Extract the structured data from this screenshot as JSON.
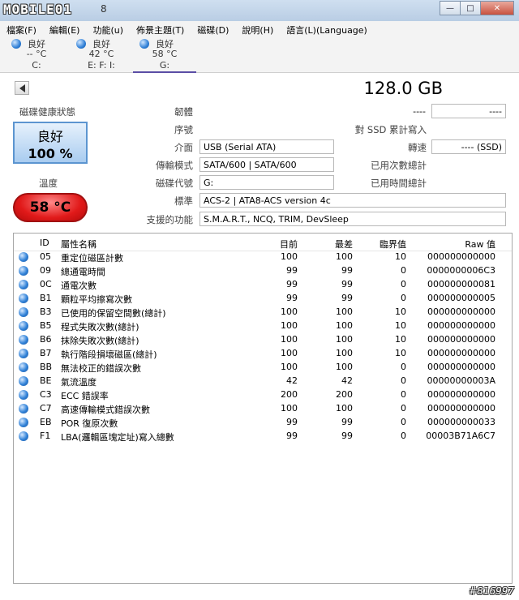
{
  "titlebar": {
    "logo": "MOBILE01",
    "version": "8",
    "controls": {
      "minimize": "—",
      "maximize": "□",
      "close": "✕"
    }
  },
  "menu": [
    "檔案(F)",
    "編輯(E)",
    "功能(u)",
    "佈景主題(T)",
    "磁碟(D)",
    "說明(H)",
    "語言(L)(Language)"
  ],
  "disks": [
    {
      "status": "良好",
      "temp": "-- °C",
      "drive": "C:"
    },
    {
      "status": "良好",
      "temp": "42 °C",
      "drive": "E: F: I:"
    },
    {
      "status": "良好",
      "temp": "58 °C",
      "drive": "G:"
    }
  ],
  "info": {
    "capacity": "128.0 GB",
    "health_label": "磁碟健康狀態",
    "health_status": "良好",
    "health_percent": "100 %",
    "temp_label": "溫度",
    "temperature": "58 °C",
    "firmware_label": "韌體",
    "firmware": "----",
    "firmware_right": "----",
    "serial_label": "序號",
    "interface_label": "介面",
    "interface": "USB (Serial ATA)",
    "transfer_label": "傳輸模式",
    "transfer": "SATA/600 | SATA/600",
    "drive_letter_label": "磁碟代號",
    "drive_letter": "G:",
    "standard_label": "標準",
    "standard": "ACS-2 | ATA8-ACS version 4c",
    "features_label": "支援的功能",
    "features": "S.M.A.R.T., NCQ, TRIM, DevSleep",
    "ssd_writes_label": "對 SSD 累計寫入",
    "rotation_label": "轉速",
    "rotation": "---- (SSD)",
    "power_count_label": "已用次數總計",
    "power_hours_label": "已用時間總計"
  },
  "smart": {
    "headers": {
      "id": "ID",
      "name": "屬性名稱",
      "current": "目前",
      "worst": "最差",
      "threshold": "臨界值",
      "raw": "Raw 值"
    },
    "rows": [
      {
        "id": "05",
        "name": "重定位磁區計數",
        "current": "100",
        "worst": "100",
        "threshold": "10",
        "raw": "000000000000"
      },
      {
        "id": "09",
        "name": "總通電時間",
        "current": "99",
        "worst": "99",
        "threshold": "0",
        "raw": "0000000006C3"
      },
      {
        "id": "0C",
        "name": "通電次數",
        "current": "99",
        "worst": "99",
        "threshold": "0",
        "raw": "000000000081"
      },
      {
        "id": "B1",
        "name": "顆粒平均擦寫次數",
        "current": "99",
        "worst": "99",
        "threshold": "0",
        "raw": "000000000005"
      },
      {
        "id": "B3",
        "name": "已使用的保留空間數(總計)",
        "current": "100",
        "worst": "100",
        "threshold": "10",
        "raw": "000000000000"
      },
      {
        "id": "B5",
        "name": "程式失敗次數(總計)",
        "current": "100",
        "worst": "100",
        "threshold": "10",
        "raw": "000000000000"
      },
      {
        "id": "B6",
        "name": "抹除失敗次數(總計)",
        "current": "100",
        "worst": "100",
        "threshold": "10",
        "raw": "000000000000"
      },
      {
        "id": "B7",
        "name": "執行階段損壞磁區(總計)",
        "current": "100",
        "worst": "100",
        "threshold": "10",
        "raw": "000000000000"
      },
      {
        "id": "BB",
        "name": "無法校正的錯誤次數",
        "current": "100",
        "worst": "100",
        "threshold": "0",
        "raw": "000000000000"
      },
      {
        "id": "BE",
        "name": "氣流溫度",
        "current": "42",
        "worst": "42",
        "threshold": "0",
        "raw": "00000000003A"
      },
      {
        "id": "C3",
        "name": "ECC 錯誤率",
        "current": "200",
        "worst": "200",
        "threshold": "0",
        "raw": "000000000000"
      },
      {
        "id": "C7",
        "name": "高速傳輸模式錯誤次數",
        "current": "100",
        "worst": "100",
        "threshold": "0",
        "raw": "000000000000"
      },
      {
        "id": "EB",
        "name": "POR 復原次數",
        "current": "99",
        "worst": "99",
        "threshold": "0",
        "raw": "000000000033"
      },
      {
        "id": "F1",
        "name": "LBA(邏輯區塊定址)寫入總數",
        "current": "99",
        "worst": "99",
        "threshold": "0",
        "raw": "00003B71A6C7"
      }
    ]
  },
  "watermark": "#816997"
}
